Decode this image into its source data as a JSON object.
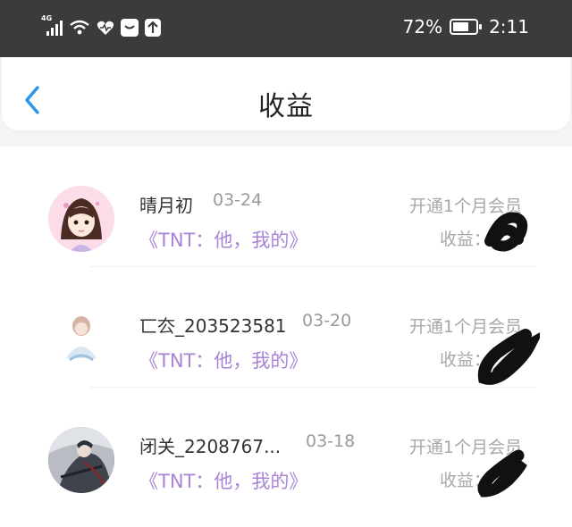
{
  "status_bar": {
    "network": "4G",
    "battery_percent": "72%",
    "battery_level": 0.72,
    "time": "2:11",
    "icons": [
      "signal-icon",
      "wifi-icon",
      "heart-pulse-icon",
      "notification-box-icon",
      "upload-icon",
      "battery-icon"
    ]
  },
  "header": {
    "title": "收益",
    "back_icon": "chevron-left-icon",
    "accent_color": "#2a95e8"
  },
  "earnings": [
    {
      "user": "晴月初",
      "date": "03-24",
      "book": "《TNT：他，我的》",
      "type": "开通1个月会员",
      "earn_label": "收益："
    },
    {
      "user": "匸厺_203523581",
      "date": "03-20",
      "book": "《TNT：他，我的》",
      "type": "开通1个月会员",
      "earn_label": "收益："
    },
    {
      "user": "闭关_2208767...",
      "date": "03-18",
      "book": "《TNT：他，我的》",
      "type": "开通1个月会员",
      "earn_label": "收益："
    }
  ],
  "colors": {
    "status_bar": "#3b3b3b",
    "book_title": "#a983d6",
    "muted_text": "#a8a8a8",
    "background": "#f4f4f4"
  }
}
